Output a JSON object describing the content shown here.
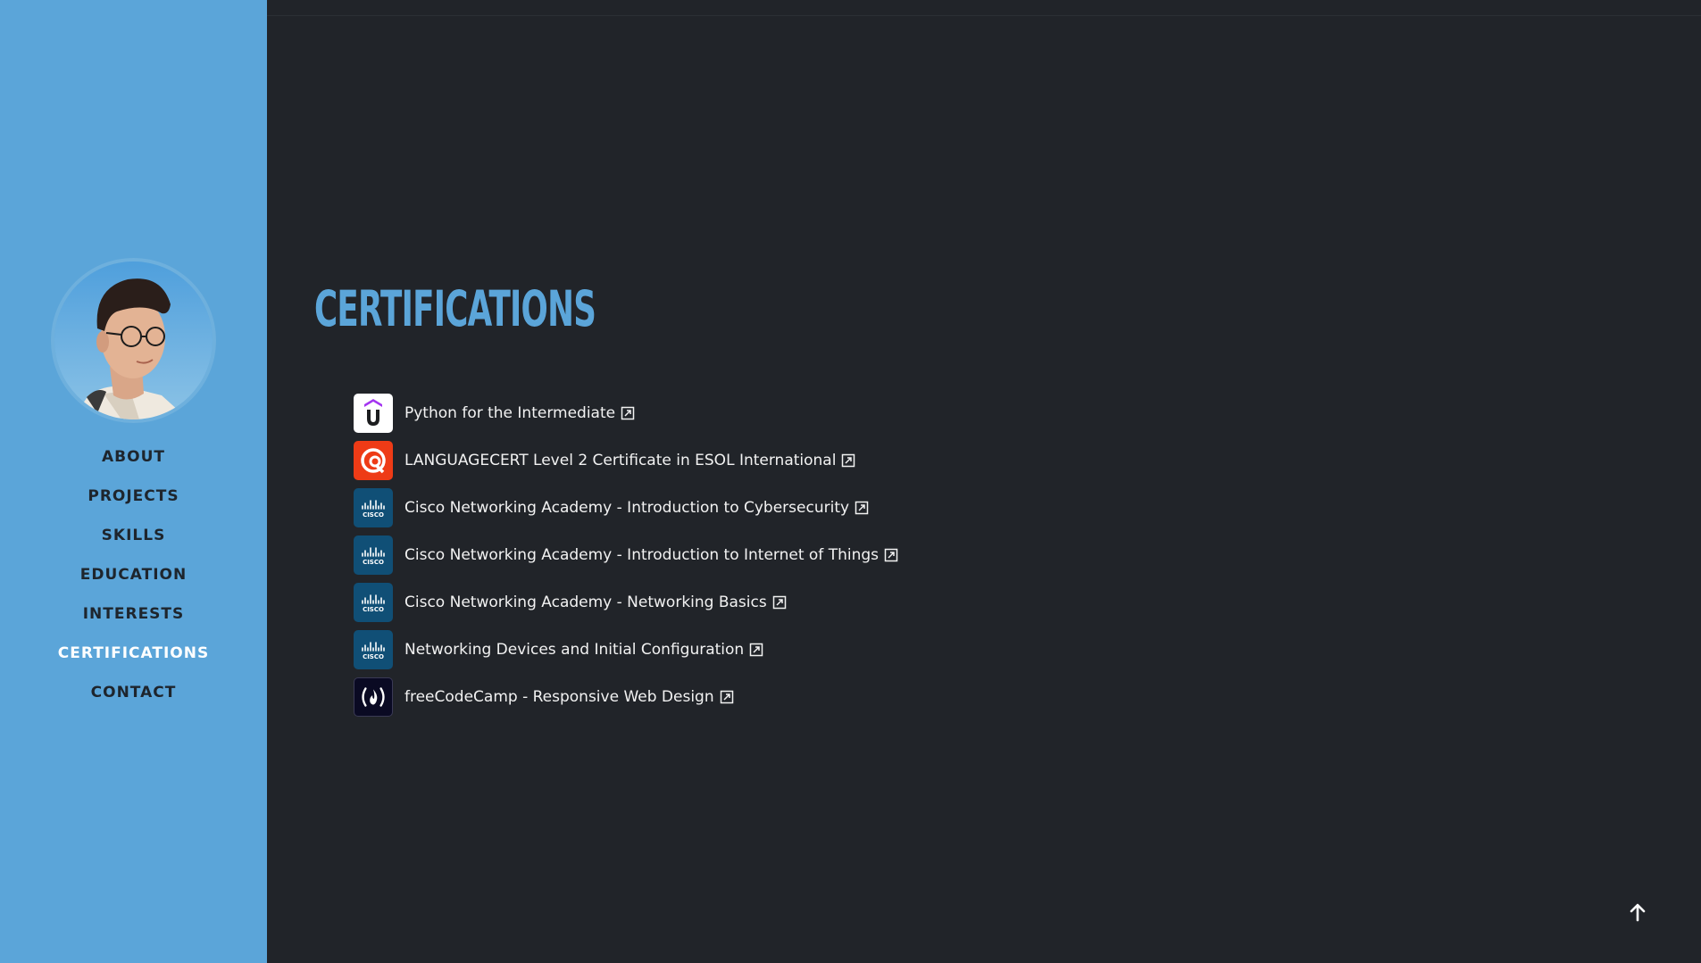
{
  "sidebar": {
    "nav": [
      {
        "label": "ABOUT"
      },
      {
        "label": "PROJECTS"
      },
      {
        "label": "SKILLS"
      },
      {
        "label": "EDUCATION"
      },
      {
        "label": "INTERESTS"
      },
      {
        "label": "CERTIFICATIONS",
        "active": true
      },
      {
        "label": "CONTACT"
      }
    ]
  },
  "main": {
    "title": "CERTIFICATIONS",
    "certifications": [
      {
        "label": "Python for the Intermediate",
        "logo": "udemy-logo"
      },
      {
        "label": "LANGUAGECERT Level 2 Certificate in ESOL International",
        "logo": "languagecert-logo"
      },
      {
        "label": "Cisco Networking Academy - Introduction to Cybersecurity",
        "logo": "cisco-logo"
      },
      {
        "label": "Cisco Networking Academy - Introduction to Internet of Things",
        "logo": "cisco-logo"
      },
      {
        "label": "Cisco Networking Academy - Networking Basics",
        "logo": "cisco-logo"
      },
      {
        "label": "Networking Devices and Initial Configuration",
        "logo": "cisco-logo"
      },
      {
        "label": "freeCodeCamp - Responsive Web Design",
        "logo": "freecodecamp-logo"
      }
    ]
  },
  "colors": {
    "sidebar_bg": "#5ba5d9",
    "page_bg": "#212429",
    "accent": "#5ba5d9",
    "nav_text": "#1e252d",
    "nav_active": "#ffffff"
  },
  "icons": {
    "back_to_top": "arrow-up-icon",
    "external": "external-link-icon"
  }
}
